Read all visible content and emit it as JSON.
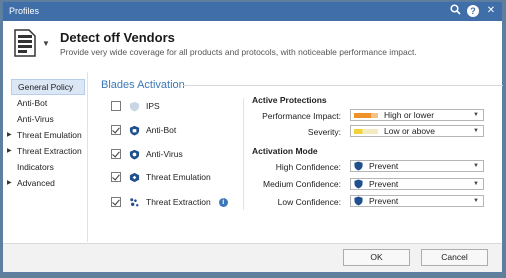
{
  "window": {
    "title": "Profiles"
  },
  "header": {
    "title": "Detect off Vendors",
    "subtitle": "Provide very wide coverage for all products and protocols, with noticeable performance impact."
  },
  "sidebar": {
    "items": [
      {
        "label": "General Policy",
        "active": true,
        "expandable": false
      },
      {
        "label": "Anti-Bot",
        "active": false,
        "expandable": false
      },
      {
        "label": "Anti-Virus",
        "active": false,
        "expandable": false
      },
      {
        "label": "Threat Emulation",
        "active": false,
        "expandable": true
      },
      {
        "label": "Threat Extraction",
        "active": false,
        "expandable": true
      },
      {
        "label": "Indicators",
        "active": false,
        "expandable": false
      },
      {
        "label": "Advanced",
        "active": false,
        "expandable": true
      }
    ]
  },
  "blades": {
    "title": "Blades Activation",
    "items": [
      {
        "label": "IPS",
        "checked": false,
        "icon": "ips-shield-icon"
      },
      {
        "label": "Anti-Bot",
        "checked": true,
        "icon": "anti-bot-icon"
      },
      {
        "label": "Anti-Virus",
        "checked": true,
        "icon": "anti-virus-icon"
      },
      {
        "label": "Threat Emulation",
        "checked": true,
        "icon": "threat-emulation-icon"
      },
      {
        "label": "Threat Extraction",
        "checked": true,
        "icon": "threat-extraction-icon"
      }
    ]
  },
  "active_protections": {
    "title": "Active Protections",
    "performance_impact": {
      "label": "Performance Impact:",
      "value": "High or lower",
      "color": "#f0922a"
    },
    "severity": {
      "label": "Severity:",
      "value": "Low or above",
      "color": "#f2d23a"
    }
  },
  "activation_mode": {
    "title": "Activation Mode",
    "high": {
      "label": "High Confidence:",
      "value": "Prevent"
    },
    "medium": {
      "label": "Medium Confidence:",
      "value": "Prevent"
    },
    "low": {
      "label": "Low Confidence:",
      "value": "Prevent"
    }
  },
  "footer": {
    "ok_label": "OK",
    "cancel_label": "Cancel"
  },
  "colors": {
    "titlebar": "#3f6ea8",
    "accent": "#3a78b7",
    "shield": "#1f4f8c"
  }
}
